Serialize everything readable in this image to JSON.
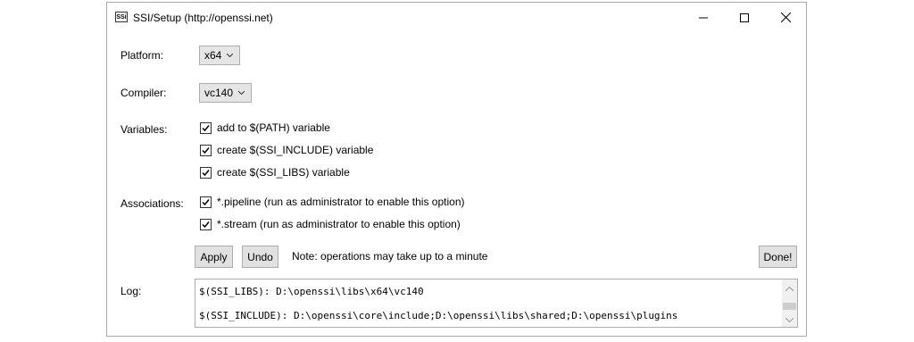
{
  "window": {
    "title": "SSI/Setup (http://openssi.net)",
    "icon_text": "SSi",
    "controls": [
      "minimize-icon",
      "maximize-icon",
      "close-icon"
    ]
  },
  "platform": {
    "label": "Platform:",
    "value": "x64"
  },
  "compiler": {
    "label": "Compiler:",
    "value": "vc140"
  },
  "variables": {
    "label": "Variables:",
    "items": [
      {
        "label": "add to $(PATH) variable",
        "checked": true
      },
      {
        "label": "create $(SSI_INCLUDE) variable",
        "checked": true
      },
      {
        "label": "create $(SSI_LIBS) variable",
        "checked": true
      }
    ]
  },
  "associations": {
    "label": "Associations:",
    "items": [
      {
        "label": "*.pipeline (run as administrator to enable this option)",
        "checked": true
      },
      {
        "label": "*.stream (run as administrator to enable this option)",
        "checked": true
      }
    ]
  },
  "actions": {
    "apply_label": "Apply",
    "undo_label": "Undo",
    "note": "Note: operations may take up to a minute",
    "done_label": "Done!"
  },
  "log": {
    "label": "Log:",
    "lines": [
      "$(SSI_LIBS): D:\\openssi\\libs\\x64\\vc140",
      "$(SSI_INCLUDE): D:\\openssi\\core\\include;D:\\openssi\\libs\\shared;D:\\openssi\\plugins"
    ]
  }
}
